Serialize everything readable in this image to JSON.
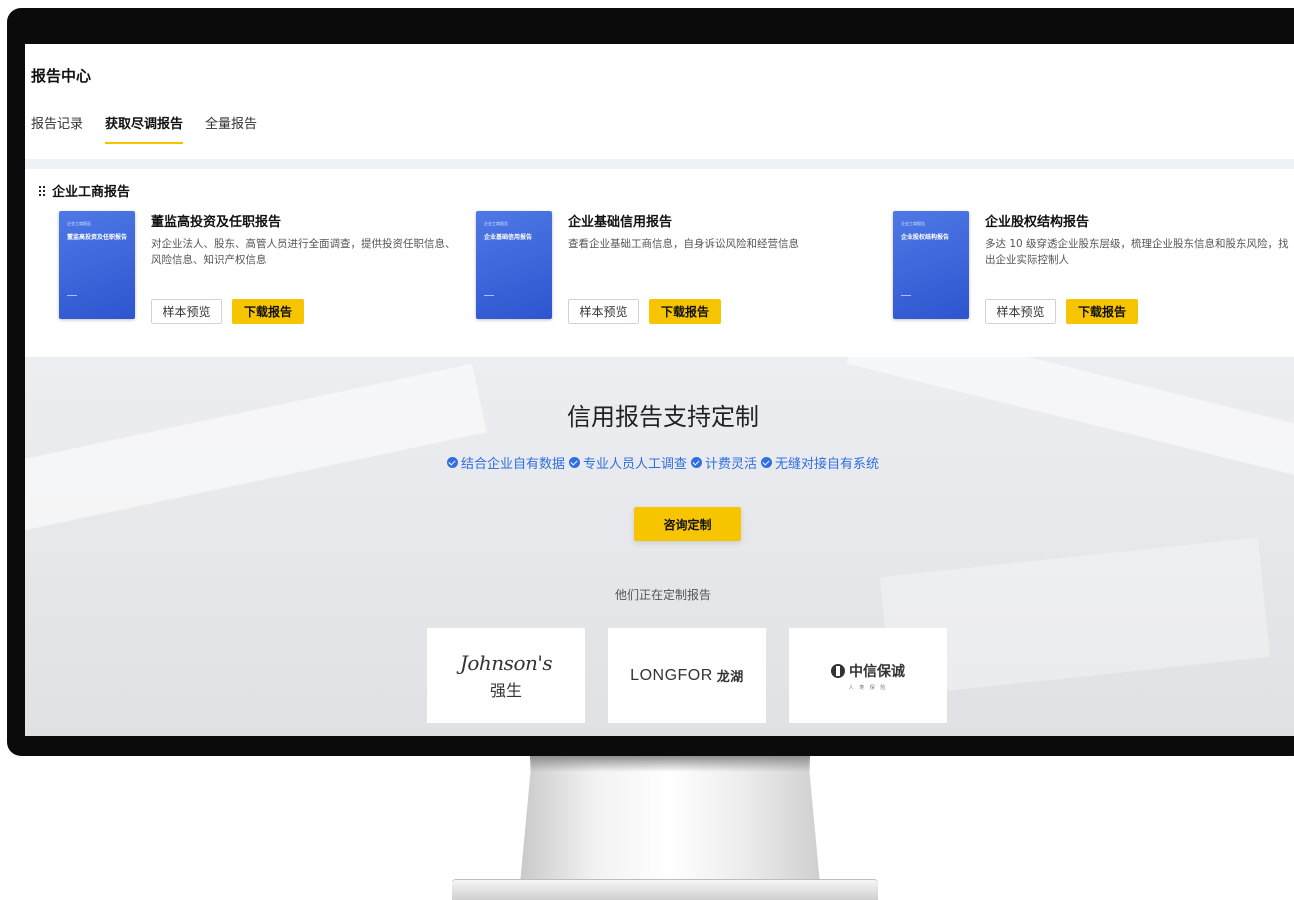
{
  "header": {
    "title": "报告中心",
    "tabs": [
      {
        "label": "报告记录",
        "active": false
      },
      {
        "label": "获取尽调报告",
        "active": true
      },
      {
        "label": "全量报告",
        "active": false
      }
    ]
  },
  "section": {
    "title": "企业工商报告",
    "cards": [
      {
        "title": "董监高投资及任职报告",
        "desc": "对企业法人、股东、高管人员进行全面调查，提供投资任职信息、风险信息、知识产权信息",
        "cover_title": "董监高投资及任职报告",
        "preview_label": "样本预览",
        "download_label": "下载报告"
      },
      {
        "title": "企业基础信用报告",
        "desc": "查看企业基础工商信息，自身诉讼风险和经营信息",
        "cover_title": "企业基础信用报告",
        "preview_label": "样本预览",
        "download_label": "下载报告"
      },
      {
        "title": "企业股权结构报告",
        "desc": "多达 10 级穿透企业股东层级，梳理企业股东信息和股东风险，找出企业实际控制人",
        "cover_title": "企业股权结构报告",
        "preview_label": "样本预览",
        "download_label": "下载报告"
      }
    ]
  },
  "promo": {
    "title": "信用报告支持定制",
    "features": [
      "结合企业自有数据",
      "专业人员人工调查",
      "计费灵活",
      "无缝对接自有系统"
    ],
    "button_label": "咨询定制",
    "customers_label": "他们正在定制报告",
    "logos": {
      "johnson_en": "Johnson's",
      "johnson_cn": "强生",
      "longfor_en": "LONGFOR",
      "longfor_cn": "龙湖",
      "citic_cn": "中信保诚",
      "citic_sub": "人 寿 保 险"
    }
  },
  "colors": {
    "accent": "#f7c500",
    "link": "#2f6fe0",
    "cover": "#3a63dc"
  }
}
